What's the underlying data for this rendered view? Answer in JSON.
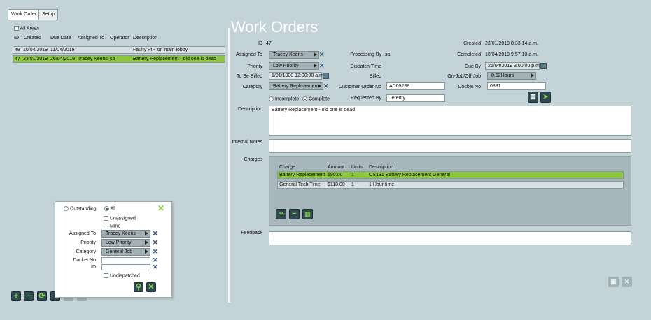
{
  "tabs": [
    "Work Order",
    "Setup"
  ],
  "list": {
    "all_areas_label": "All Areas",
    "columns": [
      "ID",
      "Created",
      "Due Date",
      "Assigned To",
      "Operator",
      "Description"
    ],
    "rows": [
      {
        "id": "48",
        "created": "10/04/2019",
        "due": "11/04/2019",
        "assigned": "",
        "operator": "",
        "description": "Faulty PIR on main lobby",
        "selected": false
      },
      {
        "id": "47",
        "created": "23/01/2019",
        "due": "26/04/2019",
        "assigned": "Tracey Keens",
        "operator": "sa",
        "description": "Battery Replacement - old one is dead",
        "selected": true
      }
    ]
  },
  "filter": {
    "outstanding_label": "Outstanding",
    "all_label": "All",
    "unassigned_label": "Unassigned",
    "mine_label": "Mine",
    "assigned_to_label": "Assigned To",
    "assigned_to_value": "Tracey Keens",
    "priority_label": "Priority",
    "priority_value": "Low Priority",
    "category_label": "Category",
    "category_value": "General Job",
    "docket_label": "Docket No",
    "id_label": "ID",
    "undispatched_label": "Undispatched"
  },
  "detail": {
    "title": "Work Orders",
    "id_label": "ID",
    "id_value": "47",
    "created_label": "Created",
    "created_value": "23/01/2019 8:33:14 a.m.",
    "assigned_label": "Assigned To",
    "assigned_value": "Tracey Keens",
    "processing_label": "Processing By",
    "processing_value": "sa",
    "completed_label": "Completed",
    "completed_value": "10/04/2019 9:57:10 a.m.",
    "priority_label": "Priority",
    "priority_value": "Low Priority",
    "dispatch_label": "Dispatch Time",
    "dueby_label": "Due By",
    "dueby_value": "26/04/2019 3:00:00 p.m.",
    "tobebilled_label": "To Be Billed",
    "tobebilled_value": "1/01/1800 12:00:00 a.m.",
    "billed_label": "Billed",
    "onjob_label": "On-Job/Off-Job",
    "onjob_value": "0.52Hours",
    "category_label": "Category",
    "category_value": "Battery Replacement",
    "custorder_label": "Customer Order No",
    "custorder_value": "AD05288",
    "docket_label": "Docket No",
    "docket_value": "0881",
    "incomplete_label": "Incomplete",
    "complete_label": "Complete",
    "requested_label": "Requested By",
    "requested_value": "Jeremy",
    "description_label": "Description",
    "description_value": "Battery Replacement - old one is dead",
    "notes_label": "Internal Notes",
    "charges_label": "Charges",
    "feedback_label": "Feedback"
  },
  "charges": {
    "columns": [
      "Charge",
      "Amount",
      "Units",
      "Description"
    ],
    "rows": [
      {
        "charge": "Battery Replacement",
        "amount": "$90.00",
        "units": "1",
        "description": "OS131 Battery Replacement General",
        "selected": true
      },
      {
        "charge": "General Tech Time",
        "amount": "$110.00",
        "units": "1",
        "description": "1 Hour time",
        "selected": false
      }
    ]
  },
  "colors": {
    "background": "#c4d3d7",
    "selected_row": "#8cc63f",
    "accent_green": "#8fd04a",
    "button_dark": "#2d4a52"
  }
}
